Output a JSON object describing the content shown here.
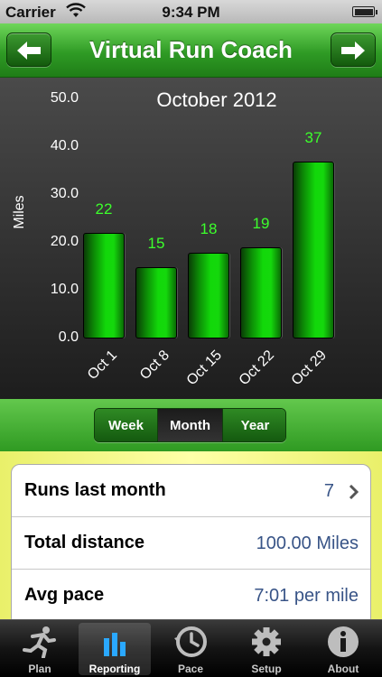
{
  "status_bar": {
    "carrier": "Carrier",
    "time": "9:34 PM"
  },
  "header": {
    "title": "Virtual Run Coach",
    "back_icon": "arrow-left-icon",
    "forward_icon": "arrow-right-icon"
  },
  "chart_data": {
    "type": "bar",
    "title": "October 2012",
    "ylabel": "Miles",
    "xlabel": "",
    "categories": [
      "Oct 1",
      "Oct 8",
      "Oct 15",
      "Oct 22",
      "Oct 29"
    ],
    "values": [
      22,
      15,
      18,
      19,
      37
    ],
    "data_labels": [
      "22",
      "15",
      "18",
      "19",
      "37"
    ],
    "yticks": [
      "0.0",
      "10.0",
      "20.0",
      "30.0",
      "40.0",
      "50.0"
    ],
    "ylim": [
      0,
      50
    ],
    "bar_color": "#14d80c",
    "label_color": "#3cff2c",
    "grid": false
  },
  "segmented": {
    "options": [
      "Week",
      "Month",
      "Year"
    ],
    "selected": "Month"
  },
  "stats": [
    {
      "label": "Runs last month",
      "value": "7",
      "disclosure": true
    },
    {
      "label": "Total distance",
      "value": "100.00 Miles",
      "disclosure": false
    },
    {
      "label": "Avg pace",
      "value": "7:01 per mile",
      "disclosure": false
    }
  ],
  "tabs": [
    {
      "label": "Plan",
      "icon": "runner-icon"
    },
    {
      "label": "Reporting",
      "icon": "bar-chart-icon"
    },
    {
      "label": "Pace",
      "icon": "clock-icon"
    },
    {
      "label": "Setup",
      "icon": "gear-icon"
    },
    {
      "label": "About",
      "icon": "info-icon"
    }
  ],
  "selected_tab": "Reporting",
  "colors": {
    "header_green": "#2f9b25",
    "value_blue": "#385487",
    "stats_background": "#f4f78a"
  }
}
